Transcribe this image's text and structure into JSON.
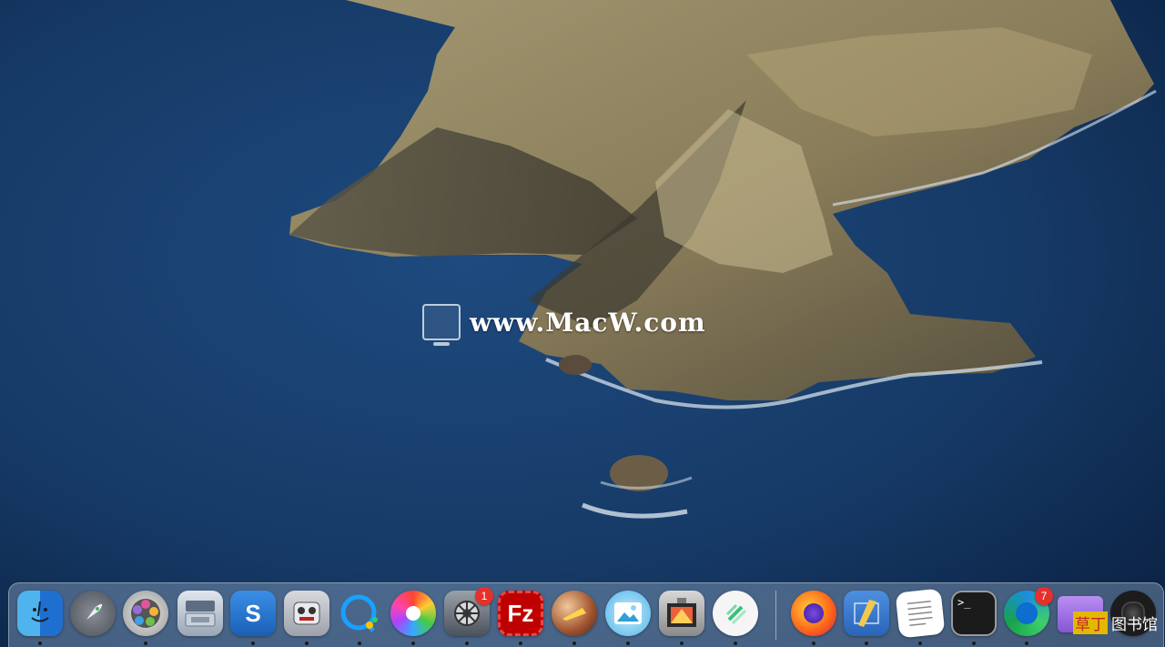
{
  "desktop": {
    "wallpaper": "catalina-island-coast",
    "watermark": "www.MacW.com"
  },
  "dock": {
    "apps": [
      {
        "name": "Finder",
        "icon": "finder-icon",
        "running": true
      },
      {
        "name": "Launchpad",
        "icon": "rocket-icon",
        "running": false
      },
      {
        "name": "Photo Theater",
        "icon": "film-reel-icon",
        "running": true
      },
      {
        "name": "Disk Utility",
        "icon": "hard-disk-icon",
        "running": false
      },
      {
        "name": "Sublime",
        "icon": "s-letter-icon",
        "running": true
      },
      {
        "name": "Automator Robot",
        "icon": "robot-icon",
        "running": true
      },
      {
        "name": "Messenger",
        "icon": "chat-bubble-icon",
        "running": true
      },
      {
        "name": "Color App",
        "icon": "color-wheel-icon",
        "running": true
      },
      {
        "name": "System Preferences",
        "icon": "gear-icon",
        "running": true,
        "badge": "1"
      },
      {
        "name": "FileZilla",
        "icon": "filezilla-icon",
        "running": true
      },
      {
        "name": "Meteor Ball",
        "icon": "fireball-icon",
        "running": true
      },
      {
        "name": "Preview",
        "icon": "image-icon",
        "running": true
      },
      {
        "name": "Photo Booth",
        "icon": "photo-booth-icon",
        "running": true
      },
      {
        "name": "Notes",
        "icon": "pen-icon",
        "running": true
      },
      {
        "name": "Firefox",
        "icon": "firefox-icon",
        "running": true
      },
      {
        "name": "Blueprint",
        "icon": "ruler-pencil-icon",
        "running": true
      },
      {
        "name": "TextEdit",
        "icon": "document-icon",
        "running": true
      },
      {
        "name": "Terminal",
        "icon": "terminal-icon",
        "running": true,
        "glyph": ">_"
      },
      {
        "name": "Edge",
        "icon": "edge-icon",
        "running": true,
        "badge": "7"
      },
      {
        "name": "Folder",
        "icon": "folder-icon",
        "running": false
      },
      {
        "name": "Camera",
        "icon": "camera-icon",
        "running": false
      }
    ],
    "corner_text": {
      "highlight": "草丁",
      "rest": "图书馆"
    }
  }
}
